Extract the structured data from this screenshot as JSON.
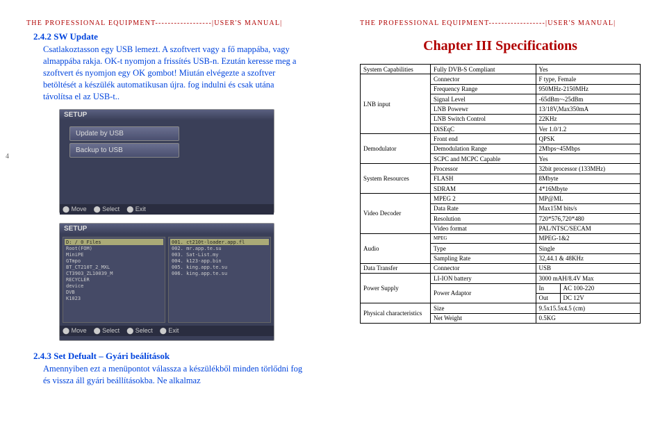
{
  "header": "THE PROFESSIONAL EQUIPMENT------------------|USER'S MANUAL|",
  "page_num": "4",
  "left": {
    "sec1_title": "2.4.2 SW Update",
    "sec1_body": "Csatlakoztasson egy USB lemezt. A szoftvert vagy a fő mappába, vagy almappába rakja. OK-t nyomjon a frissítés USB-n. Ezután keresse meg a szoftvert és nyomjon egy OK gombot! Miután elvégezte a szoftver betöltését a készülék automatikusan újra. fog indulni és csak utána távolítsa el az USB-t..",
    "sec2_title": "2.4.3 Set Defualt – Gyári beálítások",
    "sec2_body": "Amennyiben ezt a menüpontot válassza a készülékből minden törlődni fog és vissza áll gyári beállításokba. Ne alkalmaz",
    "ss1": {
      "title": "SETUP",
      "btn1": "Update by USB",
      "btn2": "Backup to USB",
      "bar": [
        "⬤ Move",
        "⬤ Select",
        "⬤ Exit"
      ]
    },
    "ss2": {
      "title": "SETUP",
      "left_hdr": "D: / 0 Files",
      "right_hdr": "",
      "left_rows": [
        "Root(FOM)",
        "MiniPE",
        "GTmpo",
        "BT_CT210T_2_MXL",
        "CT3903_ZL10039_M",
        "RECYCLER",
        "device",
        "DVB",
        "K1023"
      ],
      "right_rows": [
        "001. ct210t-loader.app.fl",
        "002. mr.app.te.su",
        "003. Sat-List.my",
        "004. k123-app.bin",
        "005. king.app.te.su",
        "006. king.app.te.su"
      ],
      "bar": [
        "⬤ Move",
        "⬤ Select",
        "⬤ Select",
        "⬤ Exit"
      ]
    }
  },
  "right": {
    "chapter": "Chapter III Specifications",
    "rows": [
      {
        "cat": "System Capabilities",
        "k": "Fully DVB-S    Compliant",
        "v": "Yes",
        "span": 1
      },
      {
        "cat": "LNB input",
        "rows": [
          [
            "Connector",
            "F type, Female"
          ],
          [
            "Frequency Range",
            "950MHz-2150MHz"
          ],
          [
            "Signal Level",
            "-65dBm~-25dBm"
          ],
          [
            "LNB Powewr",
            "13/18V,Max350mA"
          ],
          [
            "LNB Switch Control",
            "22KHz"
          ],
          [
            "DiSEqC",
            "Ver 1.0/1.2"
          ]
        ]
      },
      {
        "cat": "Demodulator",
        "rows": [
          [
            "Front end",
            "QPSK"
          ],
          [
            "Demodulation Range",
            "2Mbps~45Mbps"
          ],
          [
            "SCPC and MCPC Capable",
            "Yes"
          ]
        ]
      },
      {
        "cat": "System Resources",
        "rows": [
          [
            "Processor",
            "32bit processor (133MHz)"
          ],
          [
            "FLASH",
            "8Mbyte"
          ],
          [
            "SDRAM",
            "4*16Mbyte"
          ]
        ]
      },
      {
        "cat": "Video Decoder",
        "rows": [
          [
            "MPEG 2",
            "MP@ML"
          ],
          [
            "Data Rate",
            "Max15M bits/s"
          ],
          [
            "Resolution",
            "720*576,720*480"
          ],
          [
            "Video format",
            "PAL/NTSC/SECAM"
          ]
        ]
      },
      {
        "cat": "Audio",
        "rows": [
          [
            "MPEG",
            "MPEG-1&2"
          ],
          [
            "Type",
            "Single"
          ],
          [
            "Sampling Rate",
            "32,44.1 & 48KHz"
          ]
        ]
      },
      {
        "cat": "Data Transfer",
        "rows": [
          [
            "Connector",
            "USB"
          ]
        ]
      },
      {
        "cat": "Power Supply",
        "liion": "LI-ION battery",
        "liion_v": "3000 mAH/8.4V Max",
        "pa": "Power Adaptor",
        "in_l": "In",
        "in_v": "AC 100-220",
        "out_l": "Out",
        "out_v": "DC 12V"
      },
      {
        "cat": "Physical characteristics",
        "rows": [
          [
            "Size",
            "9.5x15.5x4.5 (cm)"
          ],
          [
            "Net Weight",
            "0.5KG"
          ]
        ]
      }
    ]
  }
}
